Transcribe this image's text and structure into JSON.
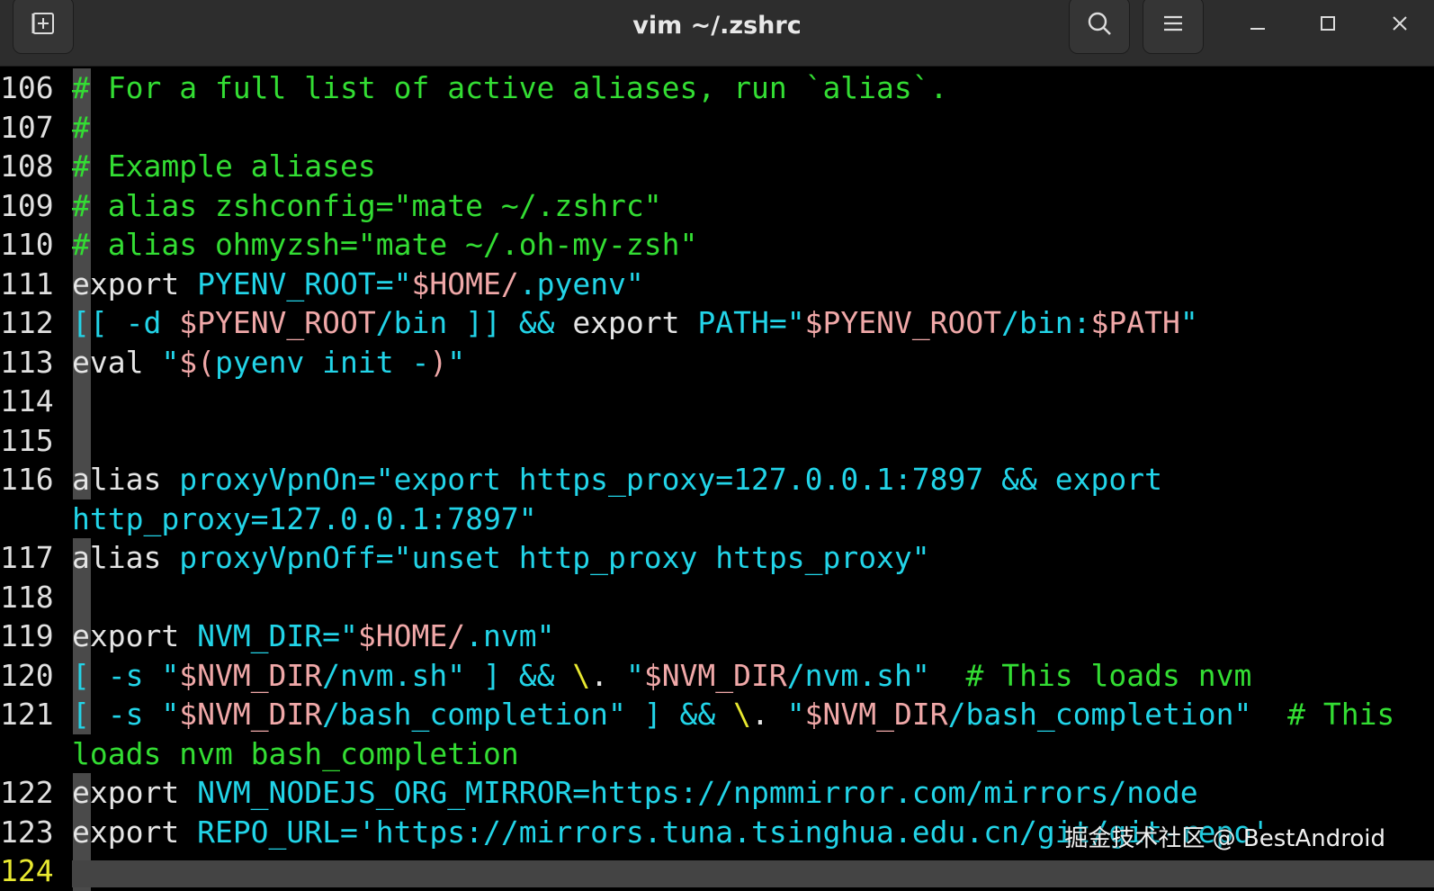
{
  "window": {
    "title": "vim ~/.zshrc",
    "icons": [
      "new-tab-icon",
      "search-icon",
      "hamburger-menu-icon",
      "minimize-icon",
      "maximize-icon",
      "close-icon"
    ]
  },
  "editor": {
    "lines": [
      {
        "n": "106",
        "segs": [
          [
            "c-com",
            "# For a full list of active aliases, run `alias`."
          ]
        ]
      },
      {
        "n": "107",
        "segs": [
          [
            "c-com",
            "#"
          ]
        ]
      },
      {
        "n": "108",
        "segs": [
          [
            "c-com",
            "# Example aliases"
          ]
        ]
      },
      {
        "n": "109",
        "segs": [
          [
            "c-com",
            "# alias zshconfig=\"mate ~/.zshrc\""
          ]
        ]
      },
      {
        "n": "110",
        "segs": [
          [
            "c-com",
            "# alias ohmyzsh=\"mate ~/.oh-my-zsh\""
          ]
        ]
      },
      {
        "n": "111",
        "segs": [
          [
            "c-wht",
            "export "
          ],
          [
            "c-cyan",
            "PYENV_ROOT=\""
          ],
          [
            "c-str",
            "$HOME/"
          ],
          [
            "c-cyan",
            ".pyenv\""
          ]
        ]
      },
      {
        "n": "112",
        "segs": [
          [
            "c-cyan",
            "[[ -d "
          ],
          [
            "c-str",
            "$PYENV_ROOT"
          ],
          [
            "c-cyan",
            "/bin ]] && "
          ],
          [
            "c-wht",
            "export "
          ],
          [
            "c-cyan",
            "PATH=\""
          ],
          [
            "c-str",
            "$PYENV_ROOT"
          ],
          [
            "c-cyan",
            "/bin:"
          ],
          [
            "c-str",
            "$PATH"
          ],
          [
            "c-cyan",
            "\""
          ]
        ]
      },
      {
        "n": "113",
        "segs": [
          [
            "c-wht",
            "eval "
          ],
          [
            "c-cyan",
            "\""
          ],
          [
            "c-str",
            "$("
          ],
          [
            "c-cyan",
            "pyenv init -"
          ],
          [
            "c-str",
            ")"
          ],
          [
            "c-cyan",
            "\""
          ]
        ]
      },
      {
        "n": "114",
        "segs": []
      },
      {
        "n": "115",
        "segs": []
      },
      {
        "n": "116",
        "segs": [
          [
            "c-wht",
            "alias "
          ],
          [
            "c-cyan",
            "proxyVpnOn=\"export https_proxy=127.0.0.1:7897 && export"
          ]
        ]
      },
      {
        "n": "",
        "segs": [
          [
            "c-cyan",
            "http_proxy=127.0.0.1:7897\""
          ]
        ]
      },
      {
        "n": "117",
        "segs": [
          [
            "c-wht",
            "alias "
          ],
          [
            "c-cyan",
            "proxyVpnOff=\"unset http_proxy https_proxy\""
          ]
        ]
      },
      {
        "n": "118",
        "segs": []
      },
      {
        "n": "119",
        "segs": [
          [
            "c-wht",
            "export "
          ],
          [
            "c-cyan",
            "NVM_DIR=\""
          ],
          [
            "c-str",
            "$HOME/"
          ],
          [
            "c-cyan",
            ".nvm\""
          ]
        ]
      },
      {
        "n": "120",
        "segs": [
          [
            "c-cyan",
            "[ -s \""
          ],
          [
            "c-str",
            "$NVM_DIR"
          ],
          [
            "c-cyan",
            "/nvm.sh\" ] && "
          ],
          [
            "c-yel",
            "\\"
          ],
          [
            "c-wht",
            ". "
          ],
          [
            "c-cyan",
            "\""
          ],
          [
            "c-str",
            "$NVM_DIR"
          ],
          [
            "c-cyan",
            "/nvm.sh\"  "
          ],
          [
            "c-com",
            "# This loads nvm"
          ]
        ]
      },
      {
        "n": "121",
        "segs": [
          [
            "c-cyan",
            "[ -s \""
          ],
          [
            "c-str",
            "$NVM_DIR"
          ],
          [
            "c-cyan",
            "/bash_completion\" ] && "
          ],
          [
            "c-yel",
            "\\"
          ],
          [
            "c-wht",
            ". "
          ],
          [
            "c-cyan",
            "\""
          ],
          [
            "c-str",
            "$NVM_DIR"
          ],
          [
            "c-cyan",
            "/bash_completion\"  "
          ],
          [
            "c-com",
            "# This"
          ]
        ]
      },
      {
        "n": "",
        "segs": [
          [
            "c-com",
            "loads nvm bash_completion"
          ]
        ]
      },
      {
        "n": "122",
        "segs": [
          [
            "c-wht",
            "export "
          ],
          [
            "c-cyan",
            "NVM_NODEJS_ORG_MIRROR=https://npmmirror.com/mirrors/node"
          ]
        ]
      },
      {
        "n": "123",
        "segs": [
          [
            "c-wht",
            "export "
          ],
          [
            "c-cyan",
            "REPO_URL='https://mirrors.tuna.tsinghua.edu.cn/git/git-repo'"
          ]
        ]
      },
      {
        "n": "124",
        "segs": []
      }
    ]
  },
  "watermark": "掘金技术社区 @ BestAndroid"
}
